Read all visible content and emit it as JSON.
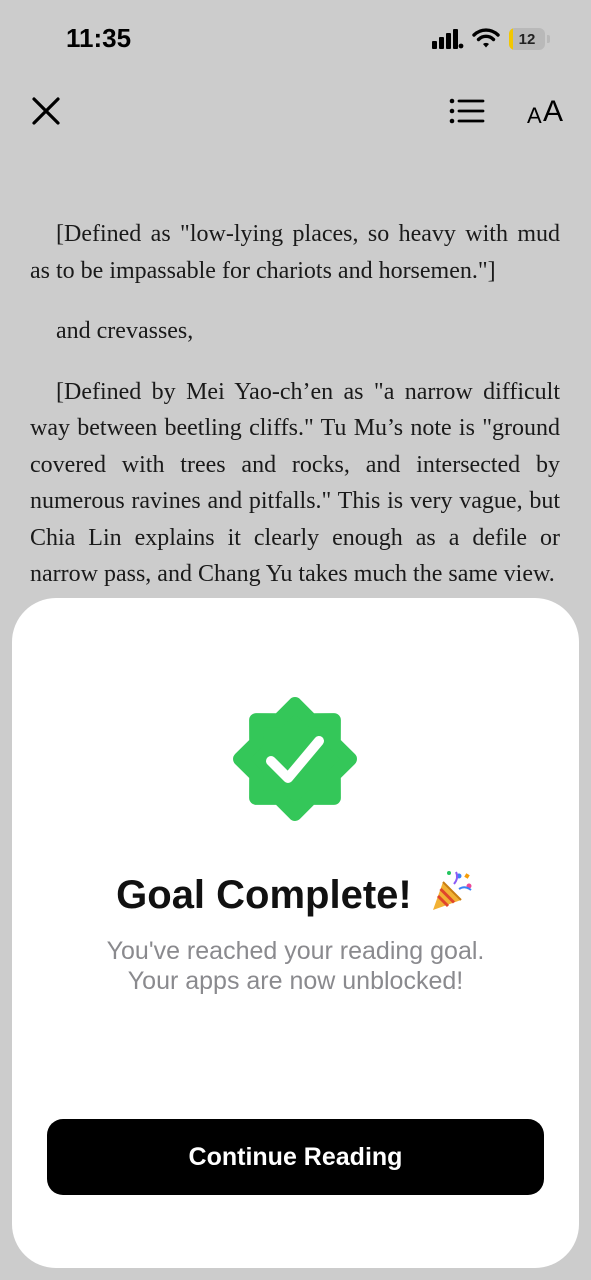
{
  "status_bar": {
    "time": "11:35",
    "battery_level": "12",
    "icons": [
      "signal-icon",
      "wifi-icon",
      "battery-icon"
    ]
  },
  "toolbar": {
    "icons": [
      "close-icon",
      "table-of-contents-icon",
      "font-size-icon"
    ],
    "font_small": "A",
    "font_big": "A"
  },
  "book": {
    "paragraphs": [
      "[Defined as \"low-lying places, so heavy with mud as to be impassable for chariots and horsemen.\"]",
      "and crevasses,",
      "[Defined by Mei Yao-ch’en as \"a narrow difficult way between beetling cliffs.\" Tu Mu’s note is \"ground covered with trees and rocks, and intersected by numerous ravines and pitfalls.\" This is very vague, but Chia Lin explains it clearly enough as a defile or narrow pass, and Chang Yu takes much the same view."
    ]
  },
  "modal": {
    "title": "Goal Complete!",
    "title_icon": "party-popper-icon",
    "badge_icon": "verified-check-badge-icon",
    "message_line1": "You've reached your reading goal.",
    "message_line2": "Your apps are now unblocked!",
    "button_label": "Continue Reading"
  },
  "colors": {
    "badge_green": "#34c759",
    "button_bg": "#000000",
    "backdrop": "#cccccc",
    "message_gray": "#8a8a8e"
  }
}
